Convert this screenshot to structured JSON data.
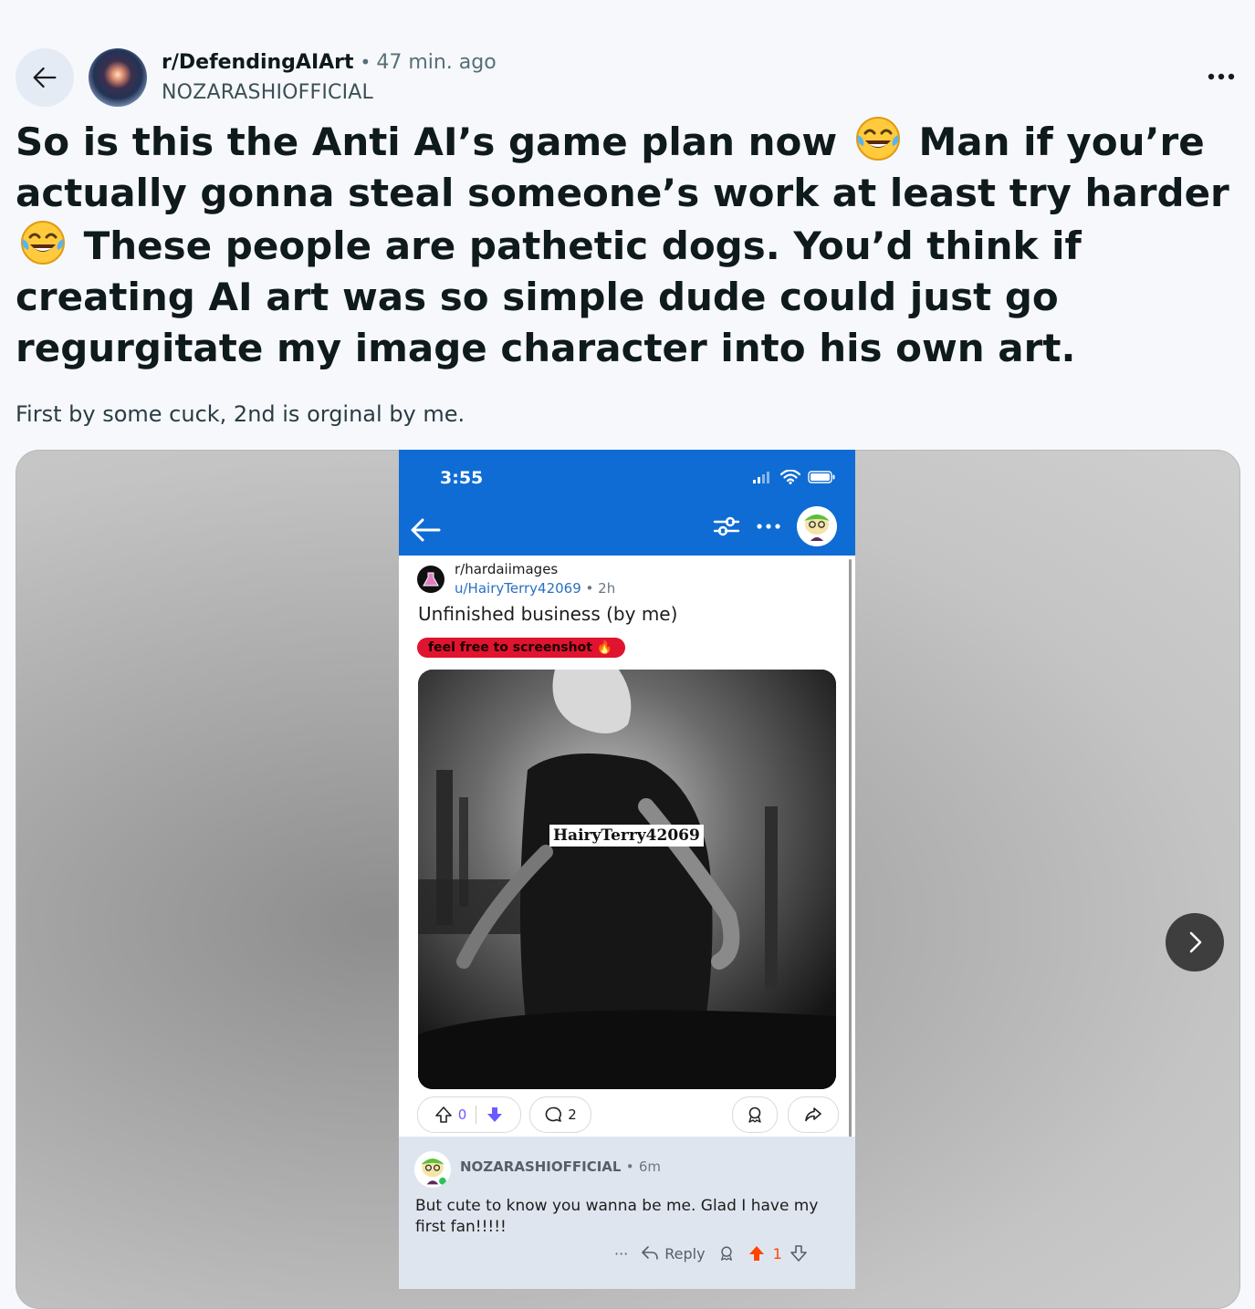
{
  "header": {
    "subreddit": "r/DefendingAIArt",
    "separator": "•",
    "time": "47 min. ago",
    "author": "NOZARASHIOFFICIAL"
  },
  "post": {
    "title_part1": "So is this the Anti AI’s game plan now",
    "title_part2": "Man if you’re actually gonna steal someone’s work at least try harder",
    "title_part3": "These people are pathetic dogs. You’d think if creating AI art was so simple dude could just go regurgitate my image character into his own art.",
    "body": "First by some cuck, 2nd is orginal by me."
  },
  "screenshot": {
    "status_time": "3:55",
    "subreddit": "r/hardaiimages",
    "user": "u/HairyTerry42069",
    "time": "2h",
    "dot": "•",
    "title": "Unfinished business (by me)",
    "flair": "feel free to screenshot 🔥",
    "watermark": "HairyTerry42069",
    "upvotes": "0",
    "comments": "2",
    "comment": {
      "author": "NOZARASHIOFFICIAL",
      "time": "6m",
      "text": "But cute to know you wanna be me. Glad I have my first fan!!!!!",
      "more": "···",
      "reply": "Reply",
      "votes": "1"
    }
  },
  "icons": {
    "back": "arrow-left-icon",
    "more": "ellipsis-icon",
    "next": "chevron-right-icon",
    "emoji": "face-with-tears-of-joy-icon"
  },
  "colors": {
    "background": "#f6f8fc",
    "reddit_blue": "#0f6cd4",
    "flair_red": "#e0142f",
    "upvote_orange": "#ff4500",
    "downvote_purple": "#6a5cff"
  }
}
